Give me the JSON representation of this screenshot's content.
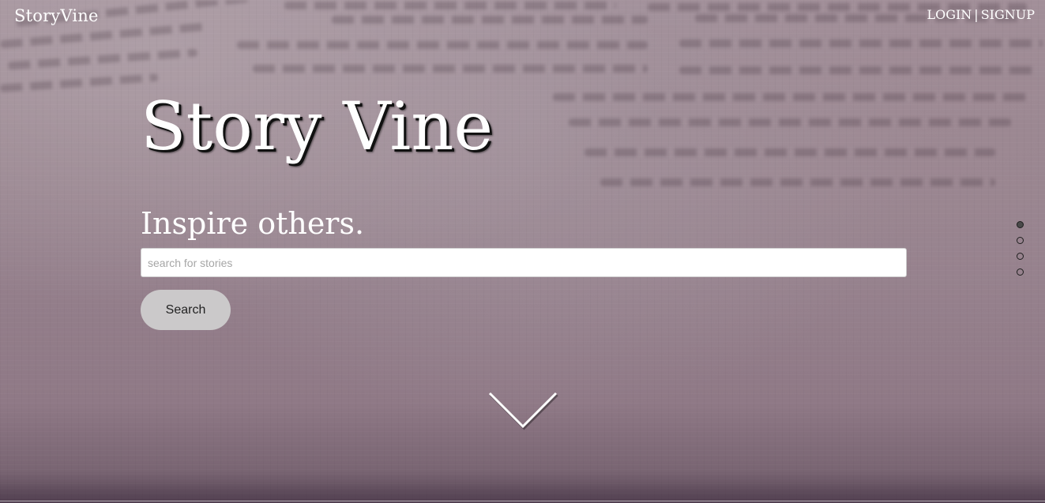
{
  "header": {
    "brand": "StoryVine",
    "login_label": "LOGIN",
    "separator": "|",
    "signup_label": "SIGNUP"
  },
  "hero": {
    "title": "Story Vine",
    "tagline": "Inspire others.",
    "search": {
      "value": "",
      "placeholder": "search for stories"
    },
    "search_button_label": "Search",
    "scroll_icon": "chevron-down-icon"
  },
  "section_nav": {
    "active_index": 0,
    "count": 4
  },
  "colors": {
    "text": "#ffffff",
    "button_bg": "#cbc9ca",
    "dot_border": "#1e1e1e"
  }
}
